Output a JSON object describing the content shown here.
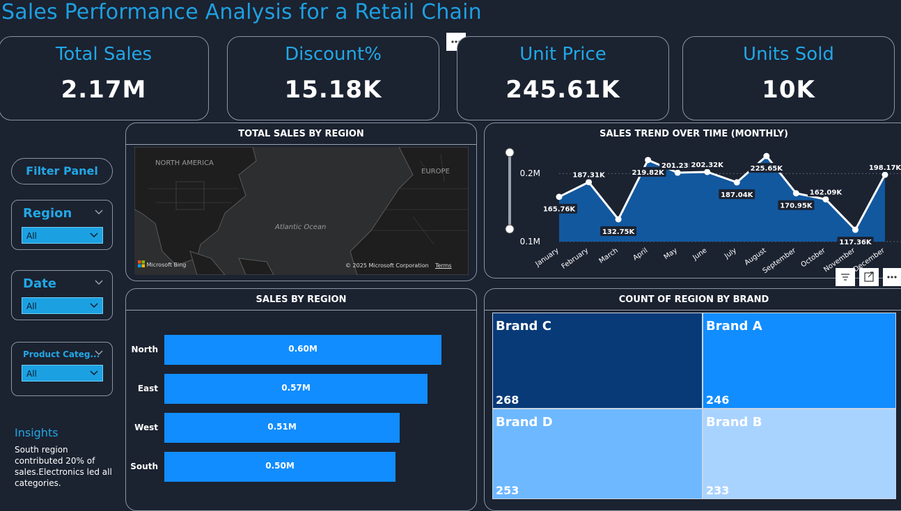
{
  "header": {
    "title": "Sales Performance Analysis for a Retail Chain"
  },
  "kpis": [
    {
      "label": "Total Sales",
      "value": "2.17M"
    },
    {
      "label": "Discount%",
      "value": "15.18K"
    },
    {
      "label": "Unit Price",
      "value": "245.61K"
    },
    {
      "label": "Units Sold",
      "value": "10K"
    }
  ],
  "sidebar": {
    "filter_panel_label": "Filter Panel",
    "slicers": [
      {
        "label": "Region",
        "selected": "All"
      },
      {
        "label": "Date",
        "selected": "All"
      },
      {
        "label": "Product Categ...",
        "selected": "All"
      }
    ],
    "insights": {
      "heading": "Insights",
      "text": "South region contributed 20% of sales.Electronics led all categories."
    }
  },
  "map_card": {
    "title": "TOTAL SALES BY REGION",
    "labels": {
      "north_america": "NORTH AMERICA",
      "europe": "EUROPE",
      "ocean": "Atlantic Ocean"
    },
    "attribution": {
      "brand": "Microsoft Bing",
      "copyright": "© 2025 Microsoft Corporation",
      "terms": "Terms"
    }
  },
  "trend_card": {
    "title": "SALES TREND OVER TIME (MONTHLY)"
  },
  "bar_card": {
    "title": "SALES BY REGION"
  },
  "treemap_card": {
    "title": "COUNT OF REGION BY BRAND",
    "tiles": [
      {
        "brand": "Brand C",
        "count": "268",
        "color": "#083a78"
      },
      {
        "brand": "Brand A",
        "count": "246",
        "color": "#118dff"
      },
      {
        "brand": "Brand D",
        "count": "253",
        "color": "#6db8ff"
      },
      {
        "brand": "Brand B",
        "count": "233",
        "color": "#a9d3ff"
      }
    ]
  },
  "colors": {
    "accent": "#1f9fe0",
    "bar": "#118dff",
    "area": "#12589f",
    "background": "#1b2230"
  },
  "chart_data": [
    {
      "type": "area",
      "title": "SALES TREND OVER TIME (MONTHLY)",
      "categories": [
        "January",
        "February",
        "March",
        "April",
        "May",
        "June",
        "July",
        "August",
        "September",
        "October",
        "November",
        "December"
      ],
      "values": [
        165760,
        187310,
        132750,
        219820,
        201230,
        202320,
        187040,
        225650,
        170950,
        162090,
        117360,
        198170
      ],
      "data_labels": [
        "165.76K",
        "187.31K",
        "132.75K",
        "219.82K",
        "201.23K",
        "202.32K",
        "187.04K",
        "225.65K",
        "170.95K",
        "162.09K",
        "117.36K",
        "198.17K"
      ],
      "y_ticks": [
        "0.1M",
        "0.2M"
      ],
      "ylim": [
        100000,
        235000
      ],
      "grid": true
    },
    {
      "type": "bar",
      "orientation": "horizontal",
      "title": "SALES BY REGION",
      "categories": [
        "North",
        "East",
        "West",
        "South"
      ],
      "values": [
        0.6,
        0.57,
        0.51,
        0.5
      ],
      "data_labels": [
        "0.60M",
        "0.57M",
        "0.51M",
        "0.50M"
      ],
      "unit": "M"
    }
  ]
}
